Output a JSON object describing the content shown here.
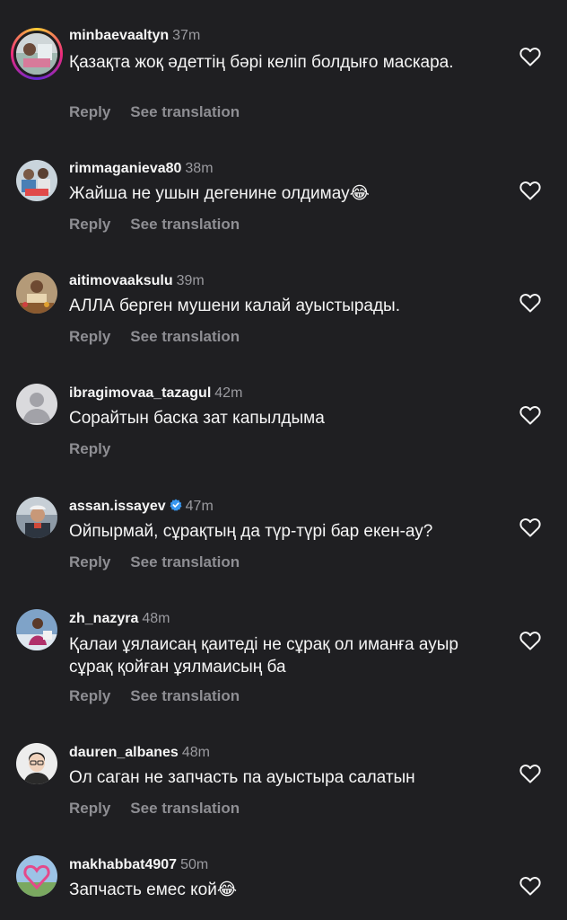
{
  "actions": {
    "reply_label": "Reply",
    "translate_label": "See translation"
  },
  "icons": {
    "like": "heart-outline-icon",
    "verified": "verified-badge-icon"
  },
  "colors": {
    "background": "#1f1f22",
    "primary_text": "#f5f5f5",
    "secondary_text": "#8e8e93",
    "verified_blue": "#3897f0"
  },
  "comments": [
    {
      "username": "minbaevaaltyn",
      "time": "37m",
      "text": "Қазақта жоқ әдеттің бәрі келіп болдығо маскара.",
      "has_story": true,
      "verified": false,
      "has_translation": true
    },
    {
      "username": "rimmaganieva80",
      "time": "38m",
      "text": "Жайша не ушын дегенине олдимау😂",
      "has_story": false,
      "verified": false,
      "has_translation": true
    },
    {
      "username": "aitimovaaksulu",
      "time": "39m",
      "text": "АЛЛА берген  мушени калай ауыстырады.",
      "has_story": false,
      "verified": false,
      "has_translation": true
    },
    {
      "username": "ibragimovaa_tazagul",
      "time": "42m",
      "text": "Сорайтын баска зат капылдыма",
      "has_story": false,
      "verified": false,
      "has_translation": false
    },
    {
      "username": "assan.issayev",
      "time": "47m",
      "text": "Ойпырмай, сұрақтың да түр-түрі бар екен-ау?",
      "has_story": false,
      "verified": true,
      "has_translation": true
    },
    {
      "username": "zh_nazyra",
      "time": "48m",
      "text": "Қалаи ұялаисаң қаитеді не сұрақ ол иманға ауыр сұрақ қойған ұялмаисың ба",
      "has_story": false,
      "verified": false,
      "has_translation": true
    },
    {
      "username": "dauren_albanes",
      "time": "48m",
      "text": "Ол саган не запчасть па ауыстыра салатын",
      "has_story": false,
      "verified": false,
      "has_translation": true
    },
    {
      "username": "makhabbat4907",
      "time": "50m",
      "text": "Запчасть емес кой😂",
      "has_story": false,
      "verified": false,
      "has_translation": false
    }
  ]
}
